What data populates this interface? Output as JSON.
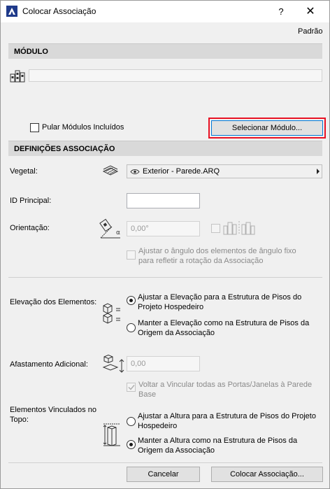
{
  "window": {
    "title": "Colocar Associação",
    "help": "?",
    "close": "✕"
  },
  "top_right_link": "Padrão",
  "module": {
    "header": "MÓDULO",
    "path_value": "",
    "skip_included_label": "Pular Módulos Incluídos",
    "select_button": "Selecionar Módulo..."
  },
  "settings": {
    "header": "DEFINIÇÕES ASSOCIAÇÃO",
    "vegetal_label": "Vegetal:",
    "vegetal_value": "Exterior - Parede.ARQ",
    "id_label": "ID Principal:",
    "id_value": "",
    "orientation_label": "Orientação:",
    "orientation_value": "0,00°",
    "adjust_angle_label_1": "Ajustar o ângulo dos elementos de ângulo fixo",
    "adjust_angle_label_2": "para refletir a rotação da Associação"
  },
  "elevation": {
    "label": "Elevação dos Elementos:",
    "opt1_line1": "Ajustar a Elevação para a Estrutura de Pisos do",
    "opt1_line2": "Projeto Hospedeiro",
    "opt2_line1": "Manter a Elevação como na Estrutura de Pisos da",
    "opt2_line2": "Origem da Associação",
    "selected": 1
  },
  "offset": {
    "label": "Afastamento Adicional:",
    "value": "0,00",
    "reconnect_line1": "Voltar a Vincular todas as Portas/Janelas à Parede",
    "reconnect_line2": "Base"
  },
  "top_linked": {
    "label_line1": "Elementos Vinculados no",
    "label_line2": "Topo:",
    "opt1_line1": "Ajustar a Altura para a Estrutura de Pisos do Projeto",
    "opt1_line2": "Hospedeiro",
    "opt2_line1": "Manter a Altura como na Estrutura de Pisos da",
    "opt2_line2": "Origem da Associação",
    "selected": 2
  },
  "footer": {
    "cancel": "Cancelar",
    "place": "Colocar Associação..."
  },
  "colors": {
    "highlight_border": "#e81123",
    "focus_border": "#0078d7"
  }
}
